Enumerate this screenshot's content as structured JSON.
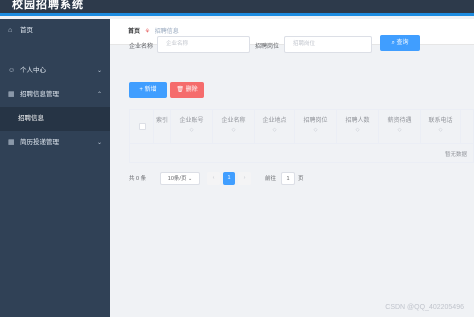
{
  "app": {
    "title": "校园招聘系统"
  },
  "sidebar": {
    "items": [
      {
        "label": "首页",
        "icon": "home-icon"
      },
      {
        "label": "个人中心",
        "icon": "user-icon"
      },
      {
        "label": "招聘信息管理",
        "icon": "grid-icon",
        "expanded": true,
        "children": [
          {
            "label": "招聘信息"
          }
        ]
      },
      {
        "label": "简历投递管理",
        "icon": "grid-icon"
      }
    ]
  },
  "breadcrumb": {
    "home": "首页",
    "current": "招聘信息"
  },
  "search": {
    "company_label": "企业名称",
    "company_placeholder": "企业名称",
    "position_label": "招聘岗位",
    "position_placeholder": "招聘岗位",
    "search_button": "查询"
  },
  "toolbar": {
    "add_label": "新增",
    "delete_label": "删除"
  },
  "table": {
    "columns": [
      {
        "label": "索引",
        "sort": ""
      },
      {
        "label": "企业账号",
        "sort": "◇"
      },
      {
        "label": "企业名称",
        "sort": "◇"
      },
      {
        "label": "企业地点",
        "sort": "◇"
      },
      {
        "label": "招聘岗位",
        "sort": "◇"
      },
      {
        "label": "招聘人数",
        "sort": "◇"
      },
      {
        "label": "薪资待遇",
        "sort": "◇"
      },
      {
        "label": "联系电话",
        "sort": "◇"
      }
    ],
    "empty_text": "暂无数据"
  },
  "pagination": {
    "total": "共 0 条",
    "page_size": "10条/页",
    "prev": "‹",
    "current_page": "1",
    "next": "›",
    "goto_label": "前往",
    "goto_value": "1",
    "page_suffix": "页"
  },
  "watermark": "CSDN @QQ_402205496",
  "colors": {
    "primary": "#409eff",
    "danger": "#f56c6c",
    "sidebar": "#304156",
    "topbar": "#2d3a4b"
  }
}
